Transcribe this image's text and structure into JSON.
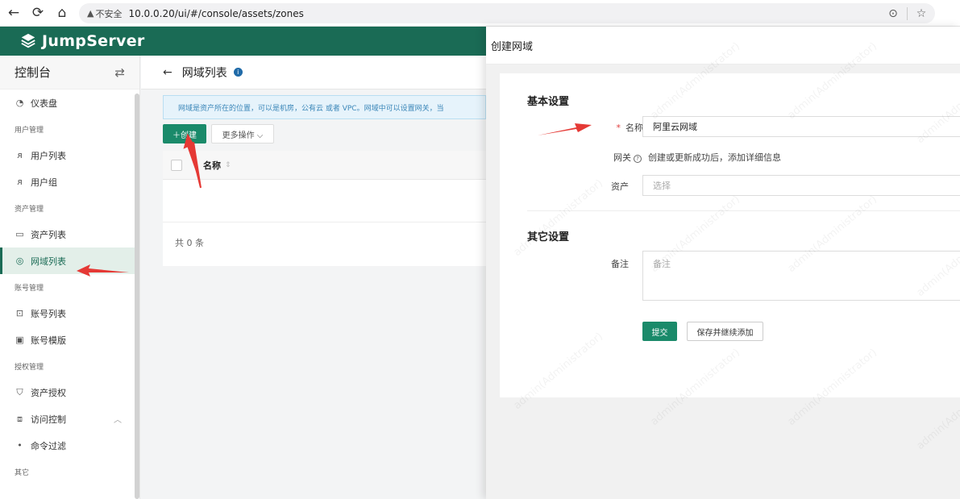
{
  "browser": {
    "back": "←",
    "forward": "→",
    "refresh": "⟳",
    "home": "⌂",
    "security_warning": "▲",
    "security_label": "不安全",
    "url": "10.0.0.20/ui/#/console/assets/zones"
  },
  "app": {
    "logo_text": "JumpServer"
  },
  "sidebar": {
    "title": "控制台",
    "items": [
      {
        "type": "item",
        "label": "仪表盘",
        "icon": "dashboard-icon"
      },
      {
        "type": "group",
        "label": "用户管理"
      },
      {
        "type": "item",
        "label": "用户列表",
        "icon": "user-icon"
      },
      {
        "type": "item",
        "label": "用户组",
        "icon": "user-group-icon"
      },
      {
        "type": "group",
        "label": "资产管理"
      },
      {
        "type": "item",
        "label": "资产列表",
        "icon": "monitor-icon"
      },
      {
        "type": "item",
        "label": "网域列表",
        "icon": "zone-icon",
        "active": true
      },
      {
        "type": "group",
        "label": "账号管理"
      },
      {
        "type": "item",
        "label": "账号列表",
        "icon": "lock-icon"
      },
      {
        "type": "item",
        "label": "账号模版",
        "icon": "template-icon"
      },
      {
        "type": "group",
        "label": "授权管理"
      },
      {
        "type": "item",
        "label": "资产授权",
        "icon": "shield-icon"
      },
      {
        "type": "item",
        "label": "访问控制",
        "icon": "access-icon"
      },
      {
        "type": "item",
        "label": "命令过滤",
        "icon": "dot-icon"
      },
      {
        "type": "group",
        "label": "其它"
      }
    ]
  },
  "main": {
    "back_arrow": "←",
    "page_title": "网域列表",
    "info_icon": "i",
    "tip": "网域是资产所在的位置，可以是机房，公有云 或者 VPC。网域中可以设置网关，当",
    "create_button": "＋创建",
    "more_actions": "更多操作 ⌵",
    "table": {
      "columns": [
        "名称"
      ],
      "sort_indicator": "⇕",
      "rows": []
    },
    "total_text": "共 0 条"
  },
  "drawer": {
    "title": "创建网域",
    "basic_section": "基本设置",
    "name_label": "名称",
    "name_required_mark": "*",
    "name_value": "阿里云网域",
    "gateway_label": "网关",
    "gateway_help_icon": "?",
    "gateway_help": "创建或更新成功后，添加详细信息",
    "assets_label": "资产",
    "assets_placeholder": "选择",
    "other_section": "其它设置",
    "comment_label": "备注",
    "comment_placeholder": "备注",
    "submit_button": "提交",
    "save_continue_button": "保存并继续添加"
  },
  "watermark": "admin(Administrator)",
  "colors": {
    "brand": "#1a6b55",
    "primary_button": "#1a8a6a",
    "arrow": "#e53935"
  }
}
